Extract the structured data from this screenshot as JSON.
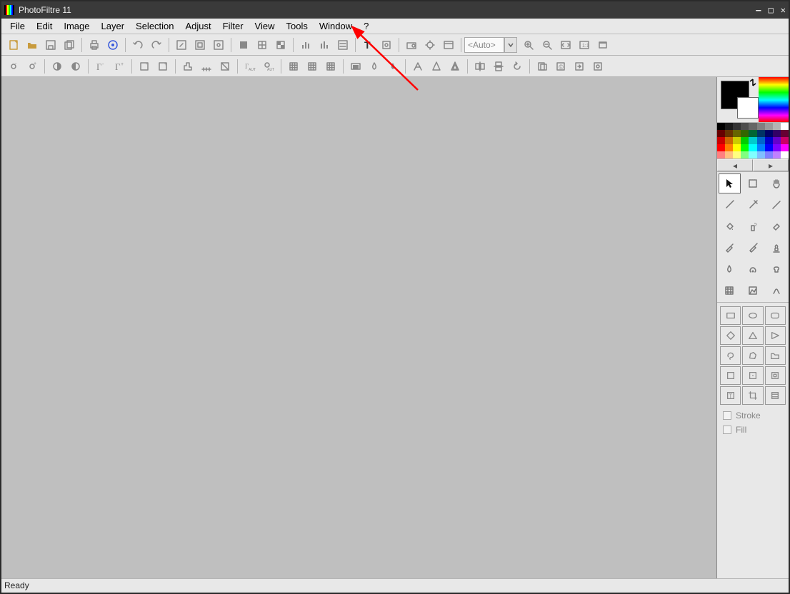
{
  "title": "PhotoFiltre 11",
  "menu": [
    "File",
    "Edit",
    "Image",
    "Layer",
    "Selection",
    "Adjust",
    "Filter",
    "View",
    "Tools",
    "Window",
    "?"
  ],
  "zoom": "<Auto>",
  "status": "Ready",
  "options": {
    "stroke": "Stroke",
    "fill": "Fill"
  },
  "toolbar1": [
    {
      "name": "new-button",
      "icon": "new"
    },
    {
      "name": "open-button",
      "icon": "open"
    },
    {
      "name": "save-button",
      "icon": "save"
    },
    {
      "name": "save-copy-button",
      "icon": "save-copy"
    },
    {
      "name": "sep"
    },
    {
      "name": "print-button",
      "icon": "print"
    },
    {
      "name": "twain-button",
      "icon": "twain"
    },
    {
      "name": "sep"
    },
    {
      "name": "undo-button",
      "icon": "undo"
    },
    {
      "name": "redo-button",
      "icon": "redo"
    },
    {
      "name": "sep"
    },
    {
      "name": "imagesize-button",
      "icon": "resize"
    },
    {
      "name": "canvassize-button",
      "icon": "canvassize"
    },
    {
      "name": "fit-image-button",
      "icon": "fit"
    },
    {
      "name": "sep"
    },
    {
      "name": "rgb-button",
      "icon": "square"
    },
    {
      "name": "indexed-button",
      "icon": "grid4"
    },
    {
      "name": "transparency-button",
      "icon": "transparency"
    },
    {
      "name": "sep"
    },
    {
      "name": "auto-levels-button",
      "icon": "histo"
    },
    {
      "name": "auto-contrast-button",
      "icon": "histo2"
    },
    {
      "name": "details-button",
      "icon": "details"
    },
    {
      "name": "sep"
    },
    {
      "name": "text-button",
      "icon": "text"
    },
    {
      "name": "transparent-color-button",
      "icon": "trans2"
    },
    {
      "name": "sep"
    },
    {
      "name": "explorer-button",
      "icon": "browse"
    },
    {
      "name": "automate-button",
      "icon": "gear"
    },
    {
      "name": "preferences-button",
      "icon": "prefs"
    },
    {
      "name": "sep"
    },
    {
      "name": "zoom-select",
      "kind": "select"
    },
    {
      "name": "zoom-in-button",
      "icon": "zoom-in"
    },
    {
      "name": "zoom-out-button",
      "icon": "zoom-out"
    },
    {
      "name": "zoom-fit-button",
      "icon": "zoom-fit"
    },
    {
      "name": "zoom-actual-button",
      "icon": "zoom-actual"
    },
    {
      "name": "fullscreen-button",
      "icon": "fullscreen"
    }
  ],
  "toolbar2": [
    {
      "name": "brightness-minus-button",
      "icon": "bright-"
    },
    {
      "name": "brightness-plus-button",
      "icon": "bright+"
    },
    {
      "name": "sep"
    },
    {
      "name": "contrast-minus-button",
      "icon": "contrast-"
    },
    {
      "name": "contrast-plus-button",
      "icon": "contrast+"
    },
    {
      "name": "sep"
    },
    {
      "name": "gamma-minus-button",
      "icon": "gamma-"
    },
    {
      "name": "gamma-plus-button",
      "icon": "gamma+"
    },
    {
      "name": "sep"
    },
    {
      "name": "sat-minus-button",
      "icon": "sat-"
    },
    {
      "name": "sat-plus-button",
      "icon": "sat+"
    },
    {
      "name": "sep"
    },
    {
      "name": "histogram-button",
      "icon": "histo3"
    },
    {
      "name": "levels-button",
      "icon": "levels"
    },
    {
      "name": "grayscale-button",
      "icon": "gray"
    },
    {
      "name": "sep"
    },
    {
      "name": "gamma-auto-button",
      "icon": "gaauto"
    },
    {
      "name": "contrast-auto-button",
      "icon": "caauto"
    },
    {
      "name": "sep"
    },
    {
      "name": "dust-button",
      "icon": "grid9"
    },
    {
      "name": "soften-button",
      "icon": "grid9b"
    },
    {
      "name": "blur-button",
      "icon": "grid9c"
    },
    {
      "name": "sep"
    },
    {
      "name": "relief-button",
      "icon": "relief"
    },
    {
      "name": "drop-button",
      "icon": "drop"
    },
    {
      "name": "drop2-button",
      "icon": "drop2"
    },
    {
      "name": "sep"
    },
    {
      "name": "antialias-button",
      "icon": "aa"
    },
    {
      "name": "outline-button",
      "icon": "outline"
    },
    {
      "name": "outline2-button",
      "icon": "outline2"
    },
    {
      "name": "sep"
    },
    {
      "name": "flip-h-button",
      "icon": "fliph"
    },
    {
      "name": "flip-v-button",
      "icon": "flipv"
    },
    {
      "name": "rotate-ccw-button",
      "icon": "rotccw"
    },
    {
      "name": "sep"
    },
    {
      "name": "rotate-cw-button",
      "icon": "rotcw"
    },
    {
      "name": "copyright-button",
      "icon": "copyright"
    },
    {
      "name": "export-button",
      "icon": "export1"
    },
    {
      "name": "export-icon-button",
      "icon": "export2"
    }
  ],
  "tools": [
    {
      "name": "pointer-tool",
      "icon": "pointer",
      "sel": true
    },
    {
      "name": "selection-tool",
      "icon": "select"
    },
    {
      "name": "hand-tool",
      "icon": "hand"
    },
    {
      "name": "pipette-tool",
      "icon": "pipette"
    },
    {
      "name": "wand-tool",
      "icon": "wand"
    },
    {
      "name": "line-tool",
      "icon": "line"
    },
    {
      "name": "fill-tool",
      "icon": "fill"
    },
    {
      "name": "spray-tool",
      "icon": "spray"
    },
    {
      "name": "eraser-tool",
      "icon": "eraser"
    },
    {
      "name": "brush-tool",
      "icon": "brush"
    },
    {
      "name": "adv-brush-tool",
      "icon": "brush2"
    },
    {
      "name": "stamp-tool",
      "icon": "stamp"
    },
    {
      "name": "blur-tool",
      "icon": "drop3"
    },
    {
      "name": "smudge-tool",
      "icon": "smudge"
    },
    {
      "name": "clone-tool",
      "icon": "clone"
    },
    {
      "name": "deform-tool",
      "icon": "deform"
    },
    {
      "name": "art-tool",
      "icon": "art"
    },
    {
      "name": "retouch-tool",
      "icon": "retouch"
    }
  ],
  "shapes": [
    {
      "name": "shape-rect",
      "icon": "rect"
    },
    {
      "name": "shape-ellipse",
      "icon": "ellipse"
    },
    {
      "name": "shape-roundrect",
      "icon": "roundrect"
    },
    {
      "name": "shape-diamond",
      "icon": "diamond"
    },
    {
      "name": "shape-triangle",
      "icon": "triangle"
    },
    {
      "name": "shape-triangle-r",
      "icon": "triangle-r"
    },
    {
      "name": "shape-lasso",
      "icon": "lasso"
    },
    {
      "name": "shape-poly",
      "icon": "poly"
    },
    {
      "name": "shape-folder",
      "icon": "folder"
    },
    {
      "name": "shape-marq1",
      "icon": "marq1"
    },
    {
      "name": "shape-marq2",
      "icon": "marq2"
    },
    {
      "name": "shape-marq3",
      "icon": "marq3"
    },
    {
      "name": "shape-marq4",
      "icon": "marq4"
    },
    {
      "name": "shape-crop",
      "icon": "crop"
    },
    {
      "name": "shape-grid",
      "icon": "gridsel"
    }
  ],
  "swatches": [
    "#000000",
    "#1a1a1a",
    "#333333",
    "#4d4d4d",
    "#666666",
    "#808080",
    "#999999",
    "#b3b3b3",
    "#ffffff",
    "#660000",
    "#663300",
    "#666600",
    "#336600",
    "#006633",
    "#003366",
    "#000066",
    "#330066",
    "#660033",
    "#cc0000",
    "#cc6600",
    "#cccc00",
    "#00cc00",
    "#00cccc",
    "#0066cc",
    "#0000cc",
    "#6600cc",
    "#cc0066",
    "#ff0000",
    "#ff8000",
    "#ffff00",
    "#00ff00",
    "#00ffff",
    "#0080ff",
    "#0000ff",
    "#8000ff",
    "#ff00ff",
    "#ff8080",
    "#ffc080",
    "#ffff80",
    "#80ff80",
    "#80ffff",
    "#80c0ff",
    "#8080ff",
    "#c080ff",
    "#ffffff"
  ]
}
